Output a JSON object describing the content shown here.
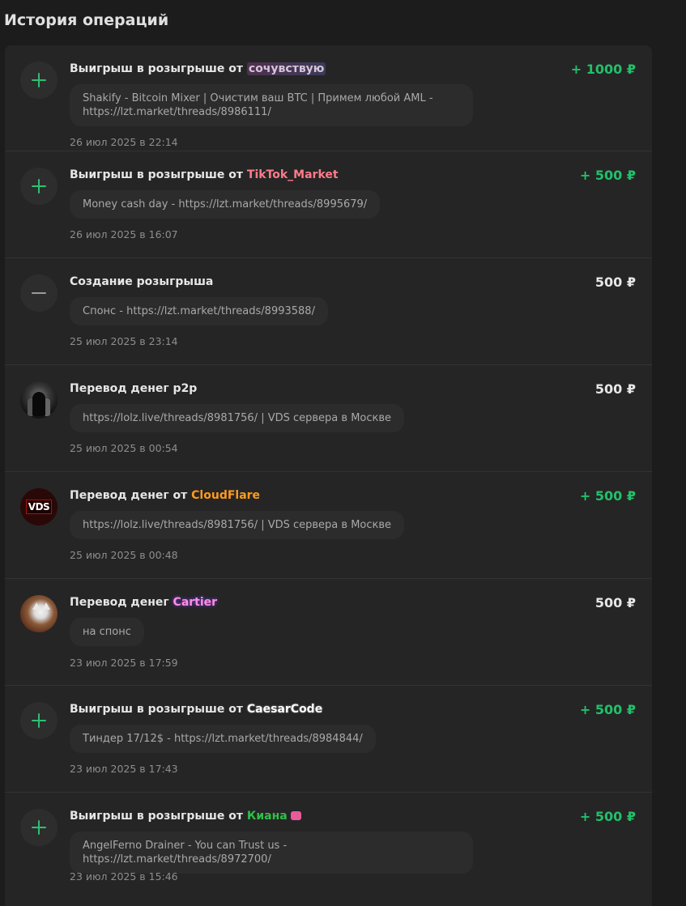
{
  "page": {
    "title": "История операций"
  },
  "colors": {
    "positive": "#22c06a",
    "neutral": "#e6e6e6",
    "background": "#1c1c1c",
    "card": "#252525"
  },
  "operations": [
    {
      "icon": "plus-icon",
      "title_prefix": "Выигрыш в розыгрыше от",
      "user": "сочувствую",
      "comment": "Shakify - Bitcoin Mixer | Очистим ваш BTC | Примем любой AML - https://lzt.market/threads/8986111/",
      "date": "26 июл 2025 в 22:14",
      "amount": "+ 1000 ₽"
    },
    {
      "icon": "plus-icon",
      "title_prefix": "Выигрыш в розыгрыше от",
      "user": "TikTok_Market",
      "comment": "Money cash day - https://lzt.market/threads/8995679/",
      "date": "26 июл 2025 в 16:07",
      "amount": "+ 500 ₽"
    },
    {
      "icon": "minus-icon",
      "title_prefix": "Создание розыгрыша",
      "user": "",
      "comment": "Спонс - https://lzt.market/threads/8993588/",
      "date": "25 июл 2025 в 23:14",
      "amount": "500 ₽"
    },
    {
      "icon": "avatar",
      "title_prefix": "Перевод денег p2p",
      "user": "",
      "comment": "https://lolz.live/threads/8981756/ | VDS сервера в Москве",
      "date": "25 июл 2025 в 00:54",
      "amount": "500 ₽"
    },
    {
      "icon": "avatar",
      "avatar_text": "VDS",
      "title_prefix": "Перевод денег от",
      "user": "CloudFlare",
      "comment": "https://lolz.live/threads/8981756/ | VDS сервера в Москве",
      "date": "25 июл 2025 в 00:48",
      "amount": "+ 500 ₽"
    },
    {
      "icon": "avatar",
      "title_prefix": "Перевод денег",
      "user": "Cartier",
      "comment": "на спонс",
      "date": "23 июл 2025 в 17:59",
      "amount": "500 ₽"
    },
    {
      "icon": "plus-icon",
      "title_prefix": "Выигрыш в розыгрыше от",
      "user": "CaesarCode",
      "comment": "Тиндер 17/12$ - https://lzt.market/threads/8984844/",
      "date": "23 июл 2025 в 17:43",
      "amount": "+ 500 ₽"
    },
    {
      "icon": "plus-icon",
      "title_prefix": "Выигрыш в розыгрыше от",
      "user": "Киана",
      "comment": "AngelFerno Drainer - You can Trust us - https://lzt.market/threads/8972700/",
      "date": "23 июл 2025 в 15:46",
      "amount": "+ 500 ₽"
    }
  ]
}
